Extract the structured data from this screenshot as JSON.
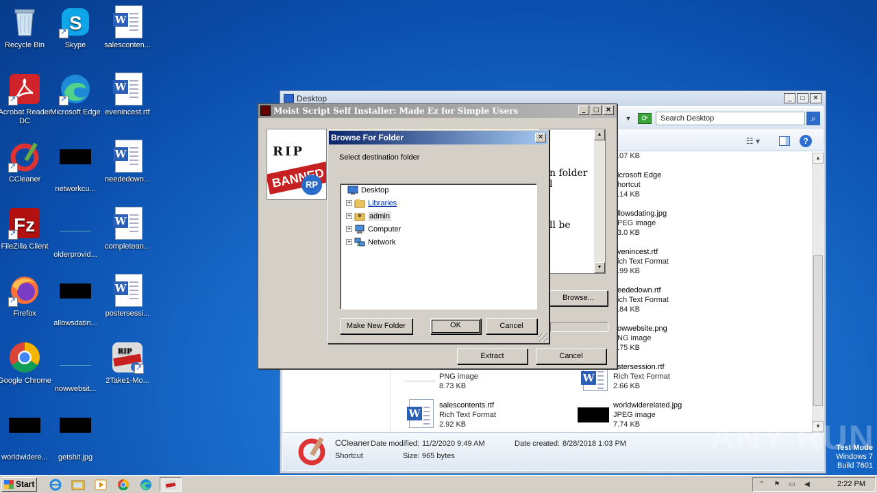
{
  "desktop": {
    "icons": [
      {
        "label": "Recycle Bin"
      },
      {
        "label": "Skype"
      },
      {
        "label": "salesconten..."
      },
      {
        "label": "Acrobat Reader DC"
      },
      {
        "label": "Microsoft Edge"
      },
      {
        "label": "evenincest.rtf"
      },
      {
        "label": "CCleaner"
      },
      {
        "label": "networkcu..."
      },
      {
        "label": "neededown..."
      },
      {
        "label": "FileZilla Client"
      },
      {
        "label": "olderprovid..."
      },
      {
        "label": "completean..."
      },
      {
        "label": "Firefox"
      },
      {
        "label": "allowsdatin..."
      },
      {
        "label": "postersessi..."
      },
      {
        "label": "Google Chrome"
      },
      {
        "label": "nowwebsit..."
      },
      {
        "label": "2Take1-Mo..."
      },
      {
        "label": "worldwidere..."
      },
      {
        "label": "getshit.jpg"
      }
    ]
  },
  "explorer": {
    "title": "Desktop",
    "search_placeholder": "Search Desktop",
    "files_right": [
      {
        "name": "",
        "type": "",
        "size": ".07 KB"
      },
      {
        "name": "icrosoft Edge",
        "type": "hortcut",
        "size": ".14 KB"
      },
      {
        "name": "llowsdating.jpg",
        "type": "PEG image",
        "size": "3.0 KB"
      },
      {
        "name": "venincest.rtf",
        "type": "ich Text Format",
        "size": ".99 KB"
      },
      {
        "name": "eededown.rtf",
        "type": "ich Text Format",
        "size": ".84 KB"
      },
      {
        "name": "owwebsite.png",
        "type": "NG image",
        "size": ".75 KB"
      },
      {
        "name": "ostersession.rtf",
        "type": "Rich Text Format",
        "size": "2.66 KB"
      },
      {
        "name": "worldwiderelated.jpg",
        "type": "JPEG image",
        "size": "7.74 KB"
      }
    ],
    "files_left": [
      {
        "name": "",
        "type": "PNG image",
        "size": "8.73 KB"
      },
      {
        "name": "salescontents.rtf",
        "type": "Rich Text Format",
        "size": "2.92 KB"
      }
    ],
    "details": {
      "name": "CCleaner",
      "kind": "Shortcut",
      "modified_label": "Date modified:",
      "modified": "11/2/2020 9:49 AM",
      "created_label": "Date created:",
      "created": "8/28/2018 1:03 PM",
      "size_label": "Size:",
      "size": "965 bytes"
    }
  },
  "installer": {
    "title": "Moist Script Self Installer: Made Ez for Simple Users",
    "text_fragments": [
      "n folder",
      "l",
      "ll be"
    ],
    "browse_label": "Browse...",
    "extract_label": "Extract",
    "cancel_label": "Cancel",
    "image_text": {
      "rip": "RIP",
      "banner": "BANNED",
      "badge": "RP"
    }
  },
  "browse_dialog": {
    "title": "Browse For Folder",
    "prompt": "Select destination folder",
    "tree": [
      {
        "label": "Desktop"
      },
      {
        "label": "Libraries"
      },
      {
        "label": "admin"
      },
      {
        "label": "Computer"
      },
      {
        "label": "Network"
      }
    ],
    "make_new_folder_label": "Make New Folder",
    "ok_label": "OK",
    "cancel_label": "Cancel"
  },
  "taskbar": {
    "start_label": "Start",
    "time": "2:22 PM"
  },
  "overlay": {
    "watermark": "ANY RUN",
    "test_mode": "Test Mode",
    "os": "Windows 7",
    "build": "Build 7601"
  }
}
